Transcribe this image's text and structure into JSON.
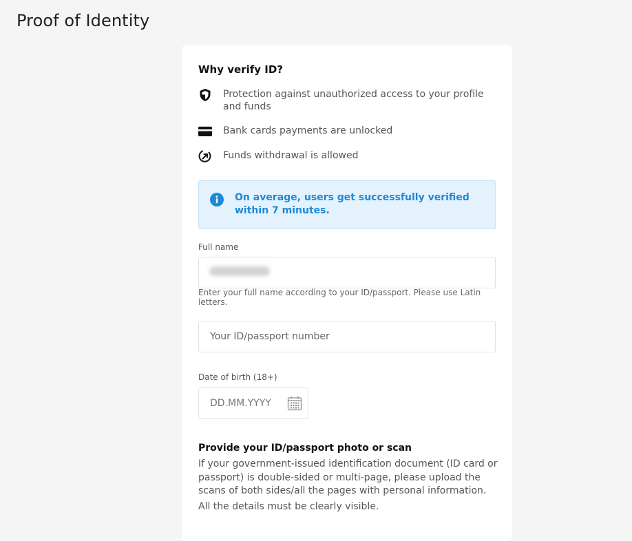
{
  "page": {
    "title": "Proof of Identity"
  },
  "why": {
    "title": "Why verify ID?",
    "benefits": [
      {
        "icon": "shield-icon",
        "text": "Protection against unauthorized access to your profile and funds"
      },
      {
        "icon": "card-icon",
        "text": "Bank cards payments are unlocked"
      },
      {
        "icon": "withdraw-icon",
        "text": "Funds withdrawal is allowed"
      }
    ]
  },
  "info": {
    "icon": "info-icon",
    "text": "On average, users get successfully verified within 7 minutes."
  },
  "form": {
    "full_name": {
      "label": "Full name",
      "value": "",
      "hint": "Enter your full name according to your ID/passport. Please use Latin letters."
    },
    "passport": {
      "placeholder": "Your ID/passport number"
    },
    "dob": {
      "label": "Date of birth (18+)",
      "placeholder": "DD.MM.YYYY",
      "icon": "calendar-icon"
    }
  },
  "upload": {
    "title": "Provide your ID/passport photo or scan",
    "description": "If your government-issued identification document (ID card or passport) is double-sided or multi-page, please upload the scans of both sides/all the pages with personal information.",
    "note": "All the details must be clearly visible."
  },
  "colors": {
    "background": "#f5f5f5",
    "card": "#ffffff",
    "info_bg": "#e3f2fc",
    "info_text": "#1e88d8"
  }
}
